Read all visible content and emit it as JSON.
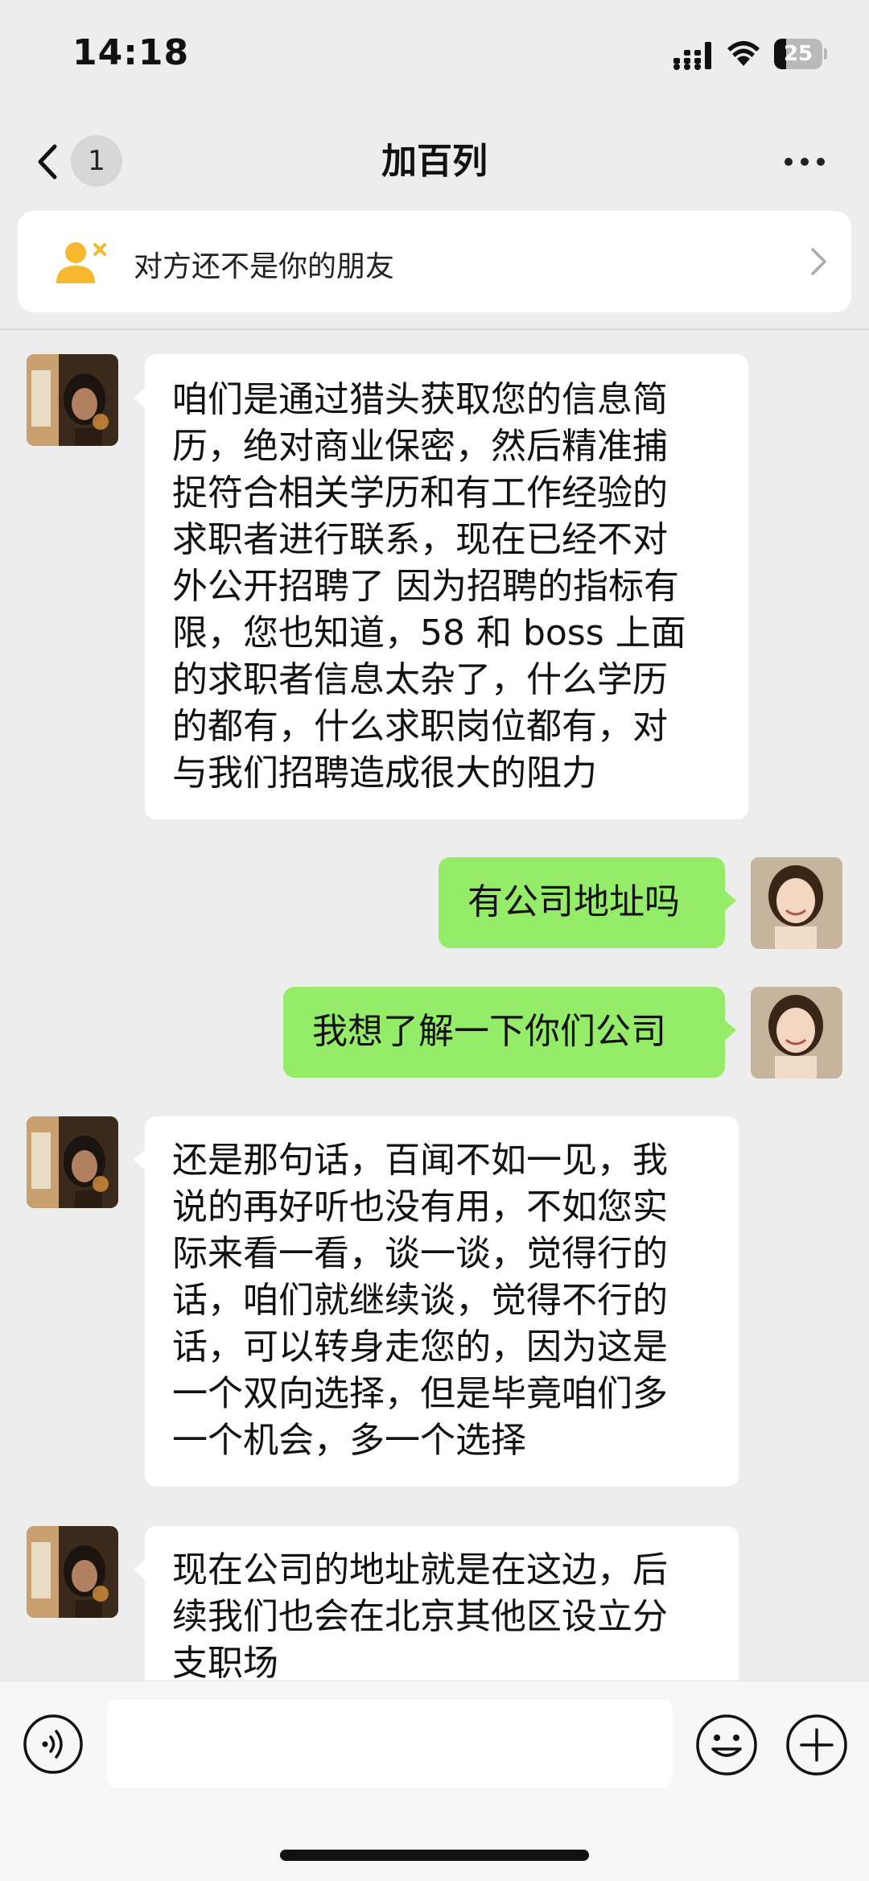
{
  "status_bar": {
    "time": "14:18",
    "battery": "25",
    "battery_level": 0.25
  },
  "header": {
    "unread_count": "1",
    "title": "加百列"
  },
  "notice": {
    "text": "对方还不是你的朋友"
  },
  "messages": [
    {
      "sender": "contact",
      "text": "咱们是通过猎头获取您的信息简\n历，绝对商业保密，然后精准捕\n捉符合相关学历和有工作经验的\n求职者进行联系，现在已经不对\n外公开招聘了 因为招聘的指标有\n限，您也知道，58 和 boss 上面\n的求职者信息太杂了，什么学历\n的都有，什么求职岗位都有，对\n与我们招聘造成很大的阻力"
    },
    {
      "sender": "me",
      "text": "有公司地址吗"
    },
    {
      "sender": "me",
      "text": "我想了解一下你们公司"
    },
    {
      "sender": "contact",
      "text": "还是那句话，百闻不如一见，我\n说的再好听也没有用，不如您实\n际来看一看，谈一谈，觉得行的\n话，咱们就继续谈，觉得不行的\n话，可以转身走您的，因为这是\n一个双向选择，但是毕竟咱们多\n一个机会，多一个选择"
    },
    {
      "sender": "contact",
      "text": "现在公司的地址就是在这边，后\n续我们也会在北京其他区设立分\n支职场"
    }
  ],
  "avatars": {
    "contact": "contact-avatar",
    "me": "user-avatar"
  },
  "colors": {
    "background": "#ededed",
    "outgoing_bubble": "#95ec69",
    "incoming_bubble": "#ffffff",
    "notice_icon": "#f5b82e"
  },
  "input_bar": {
    "value": "",
    "icons": [
      "voice-icon",
      "emoji-icon",
      "plus-icon"
    ]
  }
}
